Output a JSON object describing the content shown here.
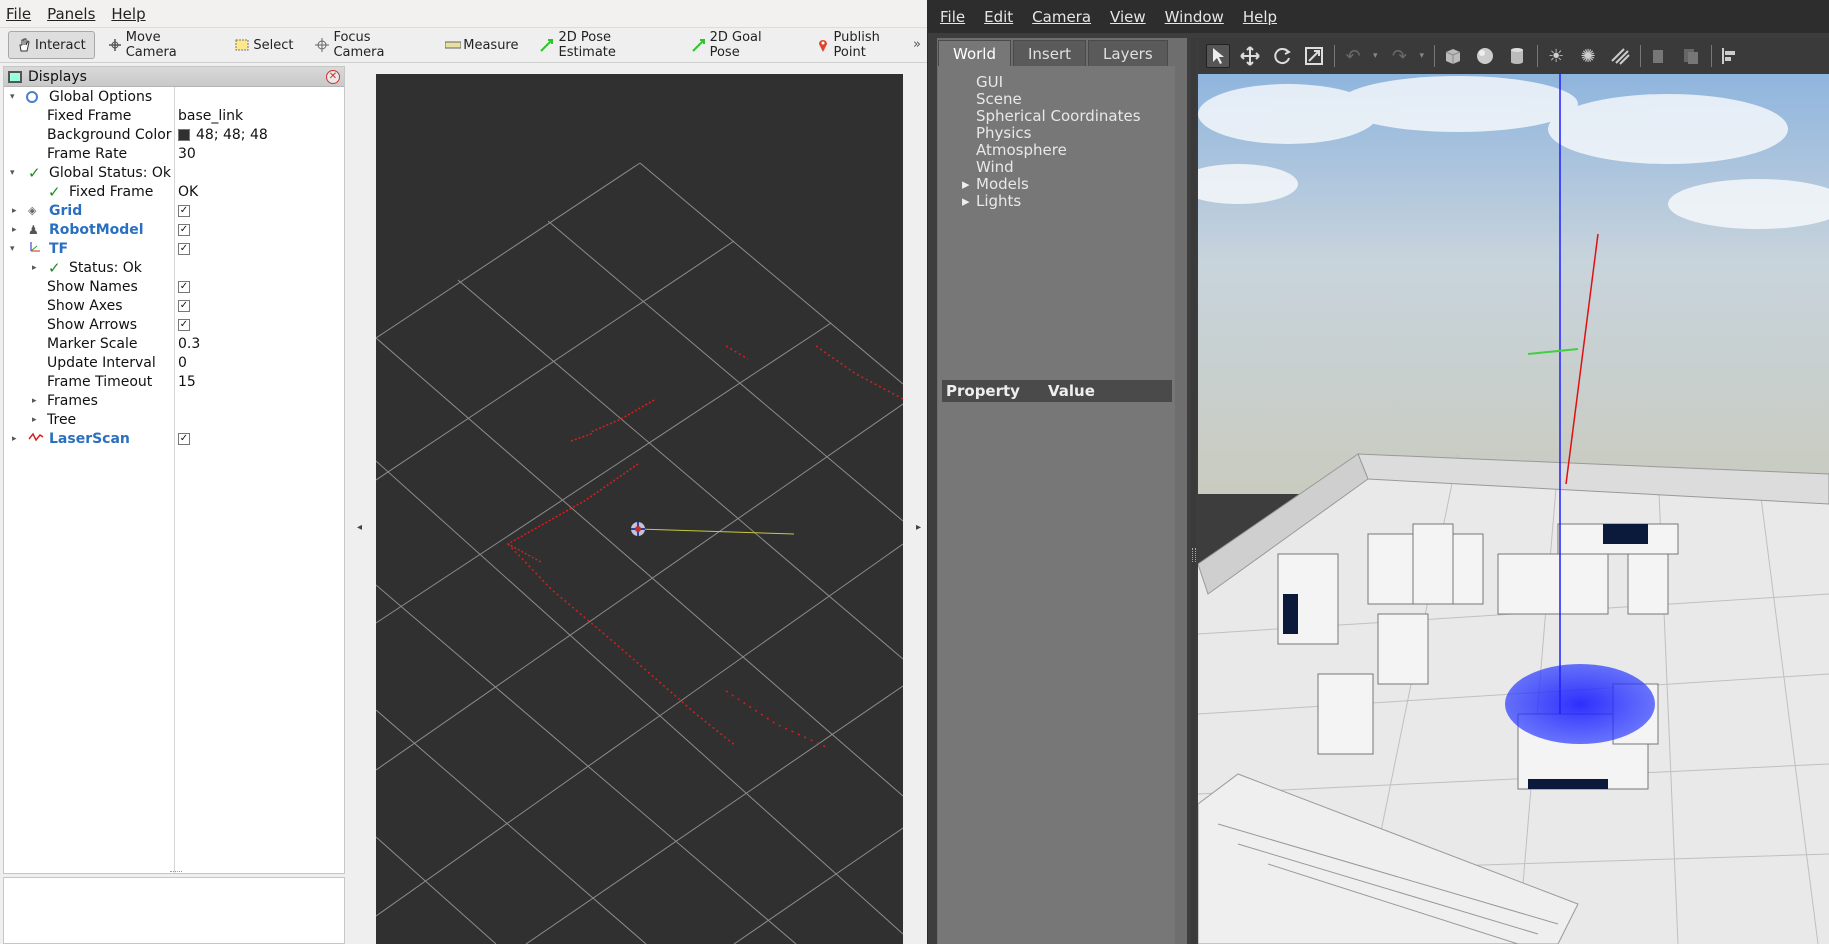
{
  "rviz": {
    "menu": [
      "File",
      "Panels",
      "Help"
    ],
    "tools": [
      {
        "label": "Interact",
        "icon": "hand-icon"
      },
      {
        "label": "Move Camera",
        "icon": "move-camera-icon"
      },
      {
        "label": "Select",
        "icon": "select-icon"
      },
      {
        "label": "Focus Camera",
        "icon": "focus-camera-icon"
      },
      {
        "label": "Measure",
        "icon": "ruler-icon"
      },
      {
        "label": "2D Pose Estimate",
        "icon": "pose-arrow-icon"
      },
      {
        "label": "2D Goal Pose",
        "icon": "goal-arrow-icon"
      },
      {
        "label": "Publish Point",
        "icon": "map-pin-icon"
      }
    ],
    "toolbar_more": "»",
    "displays_title": "Displays",
    "global_options": {
      "label": "Global Options",
      "fixed_frame_label": "Fixed Frame",
      "fixed_frame_value": "base_link",
      "background_color_label": "Background Color",
      "background_color_value": "48; 48; 48",
      "frame_rate_label": "Frame Rate",
      "frame_rate_value": "30"
    },
    "global_status": {
      "label": "Global Status: Ok",
      "fixed_frame_label": "Fixed Frame",
      "fixed_frame_value": "OK"
    },
    "displays": {
      "grid": "Grid",
      "robot_model": "RobotModel",
      "tf": "TF",
      "laser_scan": "LaserScan"
    },
    "tf_props": {
      "status": "Status: Ok",
      "show_names": "Show Names",
      "show_axes": "Show Axes",
      "show_arrows": "Show Arrows",
      "marker_scale_label": "Marker Scale",
      "marker_scale_value": "0.3",
      "update_interval_label": "Update Interval",
      "update_interval_value": "0",
      "frame_timeout_label": "Frame Timeout",
      "frame_timeout_value": "15",
      "frames": "Frames",
      "tree": "Tree"
    },
    "checkmark": "✓",
    "left_arrow": "◂",
    "right_arrow": "▸"
  },
  "gazebo": {
    "menu": [
      "File",
      "Edit",
      "Camera",
      "View",
      "Window",
      "Help"
    ],
    "tabs": [
      "World",
      "Insert",
      "Layers"
    ],
    "world_items": [
      "GUI",
      "Scene",
      "Spherical Coordinates",
      "Physics",
      "Atmosphere",
      "Wind",
      "Models",
      "Lights"
    ],
    "property_header": "Property",
    "value_header": "Value"
  },
  "colors": {
    "rviz_background": "#303030",
    "laser": "#d42020",
    "grid": "#a0a0a0",
    "gazebo_panel": "#777777",
    "highlight_blue": "#2a6fc0"
  }
}
